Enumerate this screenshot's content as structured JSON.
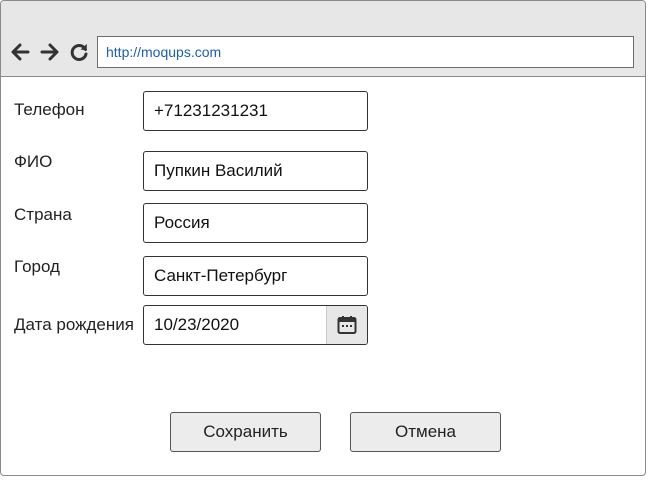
{
  "browser": {
    "url": "http://moqups.com",
    "icons": [
      "back-arrow-icon",
      "forward-arrow-icon",
      "reload-icon"
    ]
  },
  "form": {
    "phone": {
      "label": "Телефон",
      "value": "+71231231231"
    },
    "fullname": {
      "label": "ФИО",
      "value": "Пупкин Василий"
    },
    "country": {
      "label": "Страна",
      "value": "Россия"
    },
    "city": {
      "label": "Город",
      "value": "Санкт-Петербург"
    },
    "birthdate": {
      "label": "Дата рождения",
      "value": "10/23/2020",
      "icon": "calendar-icon"
    }
  },
  "buttons": {
    "save": "Сохранить",
    "cancel": "Отмена"
  },
  "colors": {
    "toolbar_bg": "#e7e7e7",
    "url_text": "#1a5fb4",
    "button_bg": "#ececec"
  }
}
